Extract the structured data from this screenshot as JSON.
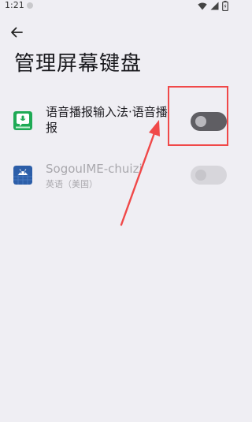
{
  "status_bar": {
    "time": "1:21",
    "icons": [
      "wifi-icon",
      "signal-icon",
      "battery-icon"
    ]
  },
  "app_bar": {
    "back_icon": "arrow-left-icon",
    "title": "管理屏幕键盘"
  },
  "keyboards": [
    {
      "title": "语音播报输入法·语音播报",
      "icon": "voice-ime-icon",
      "enabled": true,
      "available": true
    },
    {
      "title": "SogouIME-chuizi",
      "subtitle": "英语（美国）",
      "icon": "android-icon",
      "enabled": false,
      "available": false
    }
  ],
  "colors": {
    "background": "#efeef3",
    "toggle_on_track": "#5f5e63",
    "toggle_disabled_track": "#d7d6db",
    "annotation": "#f04848",
    "voice_ime_green": "#1faa55",
    "android_blue": "#2c5ea8"
  }
}
